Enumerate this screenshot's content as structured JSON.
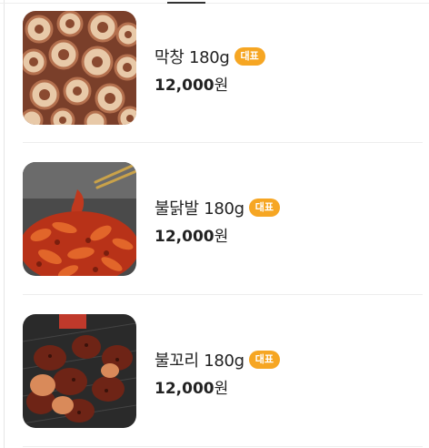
{
  "menu": {
    "items": [
      {
        "name": "막창 180g",
        "badge": "대표",
        "price": "12,000",
        "currency": "원",
        "photo_icon": "grilled-makchang-photo"
      },
      {
        "name": "불닭발 180g",
        "badge": "대표",
        "price": "12,000",
        "currency": "원",
        "photo_icon": "spicy-chicken-feet-photo"
      },
      {
        "name": "불꼬리 180g",
        "badge": "대표",
        "price": "12,000",
        "currency": "원",
        "photo_icon": "spicy-tail-photo"
      }
    ]
  },
  "colors": {
    "badge": "#f6a623",
    "text": "#222222",
    "divider": "#ededed"
  }
}
